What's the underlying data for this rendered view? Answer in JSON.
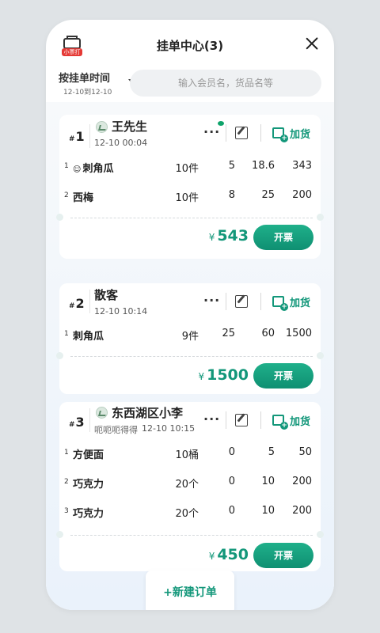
{
  "header": {
    "title": "挂单中心(3)",
    "printer_badge": "小票打印"
  },
  "filter": {
    "sort_label": "按挂单时间",
    "date_range": "12-10到12-10",
    "search_placeholder": "输入会员名，货品名等"
  },
  "orders": [
    {
      "num": "1",
      "customer": "王先生",
      "time": "12-10 00:04",
      "note": "",
      "more": "···",
      "add_label": "加货",
      "items": [
        {
          "idx": "1",
          "prefix": "☺",
          "name": "刺角瓜",
          "qty": "10件",
          "c2": "5",
          "c3": "18.6",
          "c4": "343"
        },
        {
          "idx": "2",
          "prefix": "",
          "name": "西梅",
          "qty": "10件",
          "c2": "8",
          "c3": "25",
          "c4": "200"
        }
      ],
      "total": "543",
      "currency": "¥",
      "pay_label": "开票"
    },
    {
      "num": "2",
      "customer": "散客",
      "time": "12-10 10:14",
      "note": "",
      "more": "···",
      "add_label": "加货",
      "items": [
        {
          "idx": "1",
          "prefix": "",
          "name": "刺角瓜",
          "qty": "9件",
          "c2": "25",
          "c3": "60",
          "c4": "1500"
        }
      ],
      "total": "1500",
      "currency": "¥",
      "pay_label": "开票"
    },
    {
      "num": "3",
      "customer": "东西湖区小李",
      "time": "12-10 10:15",
      "note": "呃呃呃得得",
      "more": "···",
      "add_label": "加货",
      "items": [
        {
          "idx": "1",
          "prefix": "",
          "name": "方便面",
          "qty": "10桶",
          "c2": "0",
          "c3": "5",
          "c4": "50"
        },
        {
          "idx": "2",
          "prefix": "",
          "name": "巧克力",
          "qty": "20个",
          "c2": "0",
          "c3": "10",
          "c4": "200"
        },
        {
          "idx": "3",
          "prefix": "",
          "name": "巧克力",
          "qty": "20个",
          "c2": "0",
          "c3": "10",
          "c4": "200"
        }
      ],
      "total": "450",
      "currency": "¥",
      "pay_label": "开票"
    }
  ],
  "new_order_label": "+新建订单",
  "colors": {
    "accent": "#13977a",
    "badge": "#e53935"
  },
  "icons": [
    "printer-icon",
    "close-icon",
    "chevron-down-icon",
    "avatar-icon",
    "more-icon",
    "wechat-icon",
    "edit-icon",
    "add-goods-icon"
  ]
}
